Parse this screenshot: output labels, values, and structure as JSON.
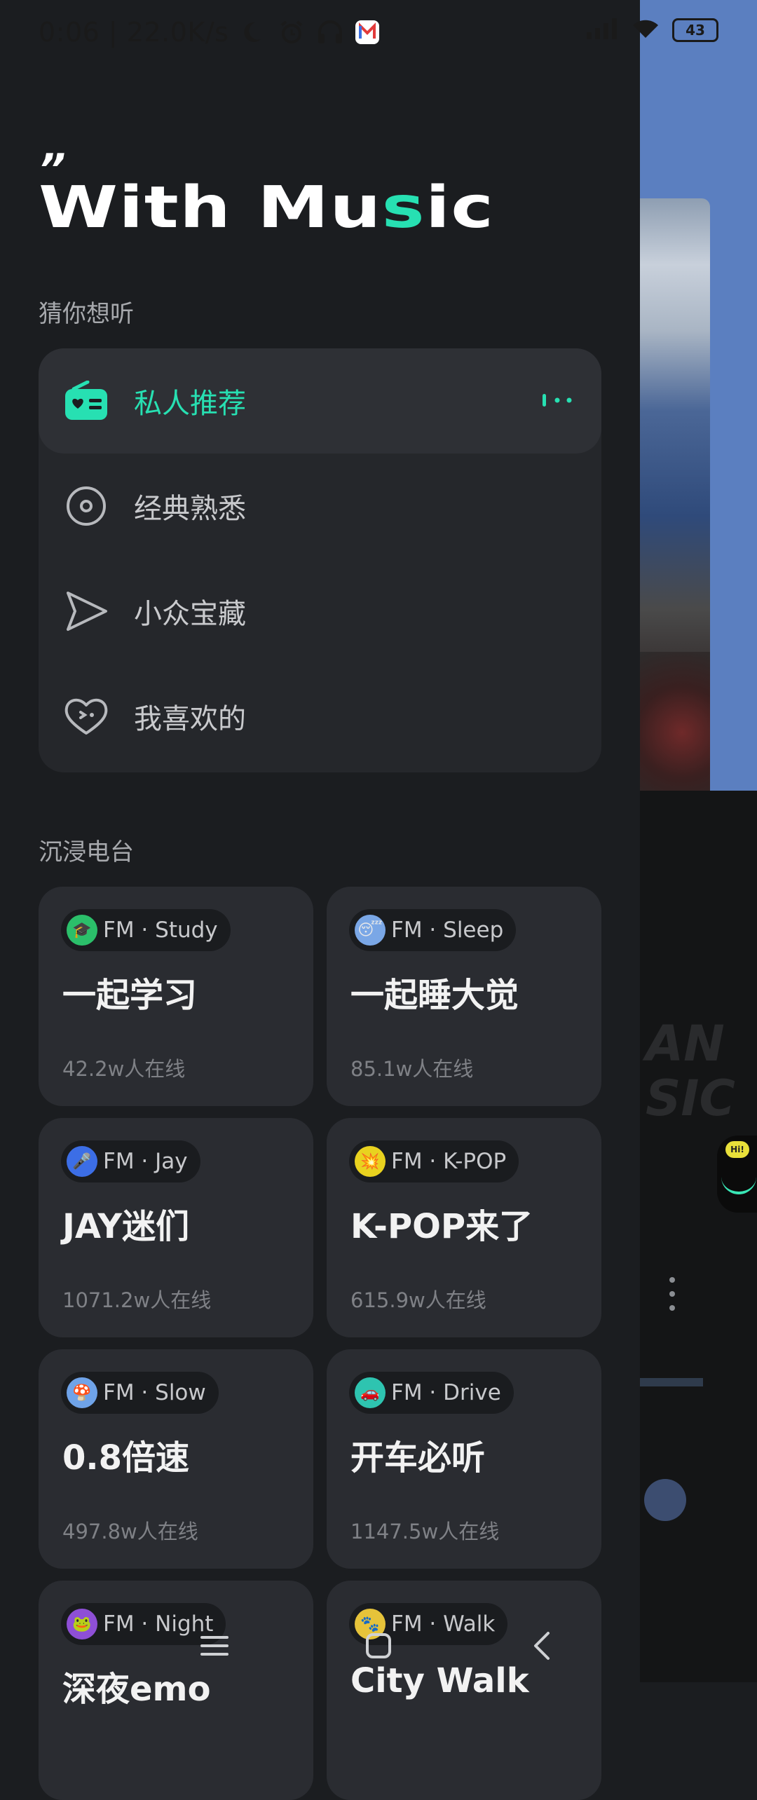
{
  "status": {
    "time_speed": "0:06 | 22.0K/s",
    "battery": "43"
  },
  "logo": {
    "quote": "”",
    "title_a": "With Mu",
    "title_hl": "s",
    "title_b": "ic"
  },
  "guess": {
    "section_title": "猜你想听",
    "items": [
      {
        "label": "私人推荐",
        "icon": "radio-icon"
      },
      {
        "label": "经典熟悉",
        "icon": "disc-icon"
      },
      {
        "label": "小众宝藏",
        "icon": "paper-plane-icon"
      },
      {
        "label": "我喜欢的",
        "icon": "heart-icon"
      }
    ]
  },
  "radio": {
    "section_title": "沉浸电台",
    "cards": [
      {
        "chip": "FM · Study",
        "name": "一起学习",
        "online": "42.2w人在线",
        "emoji": "🎓",
        "color": "#2bbf6a"
      },
      {
        "chip": "FM · Sleep",
        "name": "一起睡大觉",
        "online": "85.1w人在线",
        "emoji": "😴",
        "color": "#7aa7e6"
      },
      {
        "chip": "FM · Jay",
        "name": "JAY迷们",
        "online": "1071.2w人在线",
        "emoji": "🎤",
        "color": "#3c6ee6"
      },
      {
        "chip": "FM · K-POP",
        "name": "K-POP来了",
        "online": "615.9w人在线",
        "emoji": "💥",
        "color": "#e9d21f"
      },
      {
        "chip": "FM · Slow",
        "name": "0.8倍速",
        "online": "497.8w人在线",
        "emoji": "🍄",
        "color": "#6fa3e8"
      },
      {
        "chip": "FM · Drive",
        "name": "开车必听",
        "online": "1147.5w人在线",
        "emoji": "🚗",
        "color": "#2ec4b0"
      },
      {
        "chip": "FM · Night",
        "name": "深夜emo",
        "online": "",
        "emoji": "🐸",
        "color": "#8e4fd6"
      },
      {
        "chip": "FM · Walk",
        "name": "City Walk",
        "online": "",
        "emoji": "🐾",
        "color": "#e6c33a"
      }
    ]
  }
}
